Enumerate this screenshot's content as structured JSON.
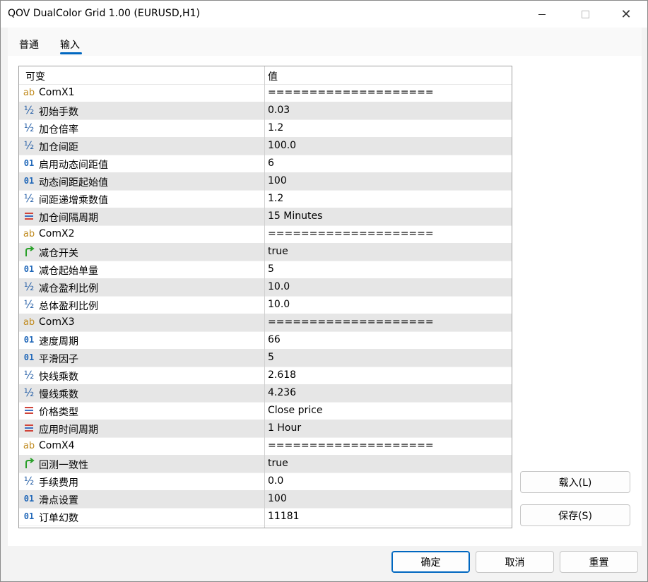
{
  "window": {
    "title": "QOV DualColor Grid 1.00 (EURUSD,H1)"
  },
  "tabs": [
    {
      "label": "普通"
    },
    {
      "label": "输入"
    }
  ],
  "grid": {
    "header_name": "可变",
    "header_value": "值",
    "rows": [
      {
        "icon": "ab",
        "name": "ComX1",
        "value": "===================="
      },
      {
        "icon": "half",
        "name": "初始手数",
        "value": "0.03"
      },
      {
        "icon": "half",
        "name": "加仓倍率",
        "value": "1.2"
      },
      {
        "icon": "half",
        "name": "加仓间距",
        "value": "100.0"
      },
      {
        "icon": "o1",
        "name": "启用动态间距值",
        "value": "6"
      },
      {
        "icon": "o1",
        "name": "动态间距起始值",
        "value": "100"
      },
      {
        "icon": "half",
        "name": "间距递增乘数值",
        "value": "1.2"
      },
      {
        "icon": "enum",
        "name": "加仓间隔周期",
        "value": "15 Minutes"
      },
      {
        "icon": "ab",
        "name": "ComX2",
        "value": "===================="
      },
      {
        "icon": "bool",
        "name": "减仓开关",
        "value": "true"
      },
      {
        "icon": "o1",
        "name": "减仓起始单量",
        "value": "5"
      },
      {
        "icon": "half",
        "name": "减仓盈利比例",
        "value": "10.0"
      },
      {
        "icon": "half",
        "name": "总体盈利比例",
        "value": "10.0"
      },
      {
        "icon": "ab",
        "name": "ComX3",
        "value": "===================="
      },
      {
        "icon": "o1",
        "name": "速度周期",
        "value": "66"
      },
      {
        "icon": "o1",
        "name": "平滑因子",
        "value": "5"
      },
      {
        "icon": "half",
        "name": "快线乘数",
        "value": "2.618"
      },
      {
        "icon": "half",
        "name": "慢线乘数",
        "value": "4.236"
      },
      {
        "icon": "enum",
        "name": "价格类型",
        "value": "Close price"
      },
      {
        "icon": "enum",
        "name": "应用时间周期",
        "value": "1 Hour"
      },
      {
        "icon": "ab",
        "name": "ComX4",
        "value": "===================="
      },
      {
        "icon": "bool",
        "name": "回测一致性",
        "value": "true"
      },
      {
        "icon": "half",
        "name": "手续费用",
        "value": "0.0"
      },
      {
        "icon": "o1",
        "name": "滑点设置",
        "value": "100"
      },
      {
        "icon": "o1",
        "name": "订单幻数",
        "value": "11181"
      }
    ]
  },
  "side_buttons": {
    "load": "载入(L)",
    "save": "保存(S)"
  },
  "footer_buttons": {
    "ok": "确定",
    "cancel": "取消",
    "reset": "重置"
  },
  "icon_glyphs": {
    "ab": "ab",
    "half": "½",
    "o1": "01"
  }
}
